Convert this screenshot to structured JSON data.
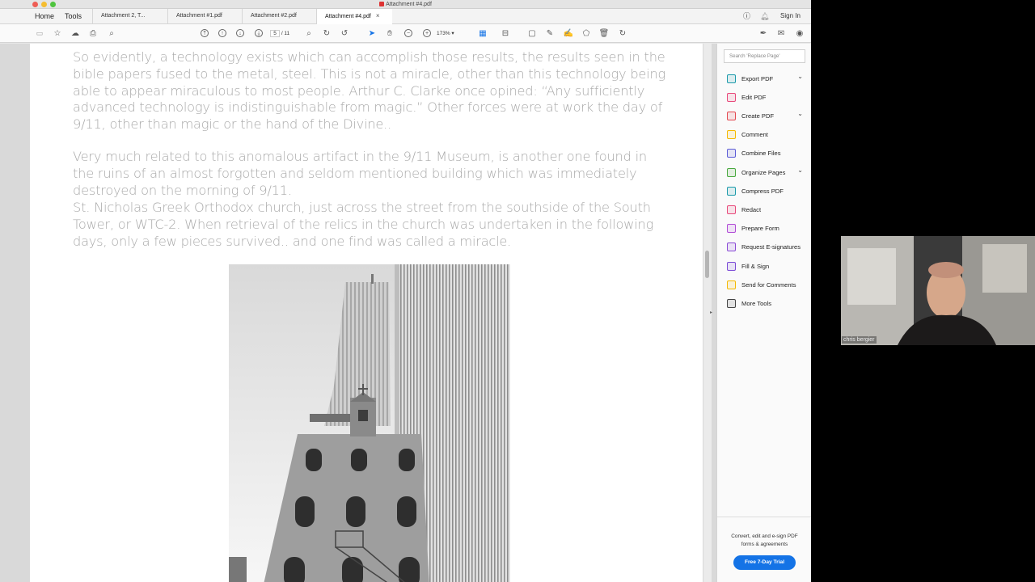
{
  "window": {
    "title": "Attachment #4.pdf"
  },
  "nav": {
    "home": "Home",
    "tools": "Tools"
  },
  "tabs": [
    {
      "label": "Attachment 2, T..."
    },
    {
      "label": "Attachment #1.pdf"
    },
    {
      "label": "Attachment #2.pdf"
    },
    {
      "label": "Attachment #4.pdf",
      "active": true,
      "close": "×"
    }
  ],
  "header_right": {
    "sign_in": "Sign In"
  },
  "toolbar": {
    "page_current": "5",
    "page_total": "/ 11",
    "zoom": "173%"
  },
  "document": {
    "paragraphs": [
      "So evidently, a technology exists which can accomplish those results, the results seen in the bible papers fused to the metal, steel. This is not a miracle, other than this technology being able to appear miraculous to most people. Arthur C. Clarke once opined: “Any sufficiently advanced technology is indistinguishable from magic.” Other forces were at work the day of 9/11, other than magic or the hand of the Divine..",
      "Very much related to this anomalous artifact in the 9/11 Museum, is another one found in the ruins of an almost forgotten and seldom mentioned building which was immediately destroyed on the morning of 9/11.",
      "St. Nicholas Greek Orthodox church, just across the street from the southside of the South Tower, or WTC-2. When retrieval of the relics in the church was undertaken in the following days, only a few pieces survived.. and one find was called a miracle."
    ]
  },
  "right_panel": {
    "search_placeholder": "Search 'Replace Page'",
    "tools": [
      {
        "label": "Export PDF",
        "color": "#1b9aaa",
        "chevron": "⌄"
      },
      {
        "label": "Edit PDF",
        "color": "#e8487a"
      },
      {
        "label": "Create PDF",
        "color": "#e34850",
        "chevron": "⌄"
      },
      {
        "label": "Comment",
        "color": "#f5b800"
      },
      {
        "label": "Combine Files",
        "color": "#5b5bd6"
      },
      {
        "label": "Organize Pages",
        "color": "#48a83e",
        "chevron": "⌄"
      },
      {
        "label": "Compress PDF",
        "color": "#1b9aaa"
      },
      {
        "label": "Redact",
        "color": "#e8487a"
      },
      {
        "label": "Prepare Form",
        "color": "#b04ad6"
      },
      {
        "label": "Request E-signatures",
        "color": "#8a4ad6"
      },
      {
        "label": "Fill & Sign",
        "color": "#7b4ad6"
      },
      {
        "label": "Send for Comments",
        "color": "#f5b800"
      },
      {
        "label": "More Tools",
        "color": "#444444"
      }
    ],
    "promo_text": "Convert, edit and e-sign PDF forms & agreements",
    "trial_button": "Free 7-Day Trial"
  },
  "webcam": {
    "name": "chris bergier"
  }
}
